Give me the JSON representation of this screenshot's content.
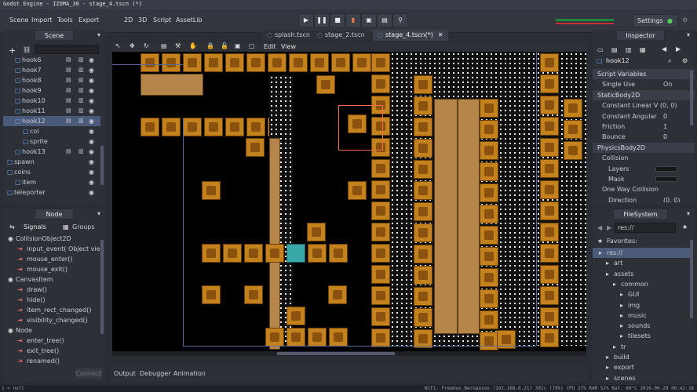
{
  "window": {
    "title": "Godot Engine - IZOMA_36 - stage_4.tscn (*)"
  },
  "menu": {
    "scene": "Scene",
    "import": "Import",
    "tools": "Tools",
    "export": "Export",
    "mode_2d": "2D",
    "mode_3d": "3D",
    "mode_script": "Script",
    "mode_assetlib": "AssetLib",
    "settings": "Settings"
  },
  "play_controls": [
    "play",
    "pause",
    "stop",
    "debug",
    "play-scene",
    "play-custom",
    "remote"
  ],
  "editor_tabs": [
    {
      "label": "splash.tscn",
      "active": false
    },
    {
      "label": "stage_2.tscn",
      "active": false
    },
    {
      "label": "stage_4.tscn(*)",
      "active": true
    }
  ],
  "viewport_menu": {
    "edit": "Edit",
    "view": "View"
  },
  "scene_dock": {
    "title": "Scene",
    "nodes": [
      {
        "label": "hook6",
        "indent": 1,
        "selected": false
      },
      {
        "label": "hook7",
        "indent": 1,
        "selected": false
      },
      {
        "label": "hook8",
        "indent": 1,
        "selected": false
      },
      {
        "label": "hook9",
        "indent": 1,
        "selected": false
      },
      {
        "label": "hook10",
        "indent": 1,
        "selected": false
      },
      {
        "label": "hook11",
        "indent": 1,
        "selected": false
      },
      {
        "label": "hook12",
        "indent": 1,
        "selected": true
      },
      {
        "label": "col",
        "indent": 2,
        "selected": false
      },
      {
        "label": "sprite",
        "indent": 2,
        "selected": false
      },
      {
        "label": "hook13",
        "indent": 1,
        "selected": false
      },
      {
        "label": "spawn",
        "indent": 0,
        "selected": false
      },
      {
        "label": "coins",
        "indent": 0,
        "selected": false
      },
      {
        "label": "item",
        "indent": 1,
        "selected": false
      },
      {
        "label": "teleporter",
        "indent": 0,
        "selected": false
      }
    ]
  },
  "node_dock": {
    "title": "Node",
    "tab_signals": "Signals",
    "tab_groups": "Groups",
    "rows": [
      {
        "label": "CollisionObject2D",
        "type": "class"
      },
      {
        "label": "input_event( Object viewp",
        "type": "signal"
      },
      {
        "label": "mouse_enter()",
        "type": "signal"
      },
      {
        "label": "mouse_exit()",
        "type": "signal"
      },
      {
        "label": "CanvasItem",
        "type": "class"
      },
      {
        "label": "draw()",
        "type": "signal"
      },
      {
        "label": "hide()",
        "type": "signal"
      },
      {
        "label": "item_rect_changed()",
        "type": "signal"
      },
      {
        "label": "visibility_changed()",
        "type": "signal"
      },
      {
        "label": "Node",
        "type": "class"
      },
      {
        "label": "enter_tree()",
        "type": "signal"
      },
      {
        "label": "exit_tree()",
        "type": "signal"
      },
      {
        "label": "renamed()",
        "type": "signal"
      }
    ],
    "connect_label": "Connect"
  },
  "inspector": {
    "title": "Inspector",
    "node_name": "hook12",
    "rows": [
      {
        "label": "Script Variables",
        "type": "section",
        "value": ""
      },
      {
        "label": "Single Use",
        "type": "prop",
        "value": "On"
      },
      {
        "label": "StaticBody2D",
        "type": "section",
        "value": ""
      },
      {
        "label": "Constant Linear V (0, 0)",
        "type": "prop",
        "value": ""
      },
      {
        "label": "Constant Angular",
        "type": "prop",
        "value": "0"
      },
      {
        "label": "Friction",
        "type": "prop",
        "value": "1"
      },
      {
        "label": "Bounce",
        "type": "prop",
        "value": "0"
      },
      {
        "label": "PhysicsBody2D",
        "type": "section",
        "value": ""
      },
      {
        "label": "Collision",
        "type": "prop",
        "value": ""
      },
      {
        "label": "Layers",
        "type": "sub",
        "value": ""
      },
      {
        "label": "Mask",
        "type": "sub",
        "value": ""
      },
      {
        "label": "One Way Collision",
        "type": "prop",
        "value": ""
      },
      {
        "label": "Direction",
        "type": "sub",
        "value": "(0, 0)"
      }
    ]
  },
  "filesystem": {
    "title": "FileSystem",
    "path": "res://",
    "favorites_label": "Favorites:",
    "items": [
      {
        "label": "res://",
        "indent": 0,
        "selected": true
      },
      {
        "label": "art",
        "indent": 1,
        "selected": false
      },
      {
        "label": "assets",
        "indent": 1,
        "selected": false
      },
      {
        "label": "common",
        "indent": 2,
        "selected": false
      },
      {
        "label": "GUI",
        "indent": 3,
        "selected": false
      },
      {
        "label": "img",
        "indent": 3,
        "selected": false
      },
      {
        "label": "music",
        "indent": 3,
        "selected": false
      },
      {
        "label": "sounds",
        "indent": 3,
        "selected": false
      },
      {
        "label": "tilesets",
        "indent": 3,
        "selected": false
      },
      {
        "label": "tr",
        "indent": 2,
        "selected": false
      },
      {
        "label": "build",
        "indent": 1,
        "selected": false
      },
      {
        "label": "export",
        "indent": 1,
        "selected": false
      },
      {
        "label": "scenes",
        "indent": 1,
        "selected": false
      }
    ]
  },
  "bottom_tabs": {
    "output": "Output",
    "debugger": "Debugger",
    "animation": "Animation"
  },
  "status": {
    "left": "1 < null",
    "right": "Wifi: Freebox_Bernaoson (192.168.0.21)  301c (79%)  CPU 27%  RAM 52%  Bat: 60°C  2016-06-29 06:42:38"
  },
  "colors": {
    "accent": "#4a5a78",
    "tile": "#c4821f",
    "selection": "#ff6a4a"
  }
}
